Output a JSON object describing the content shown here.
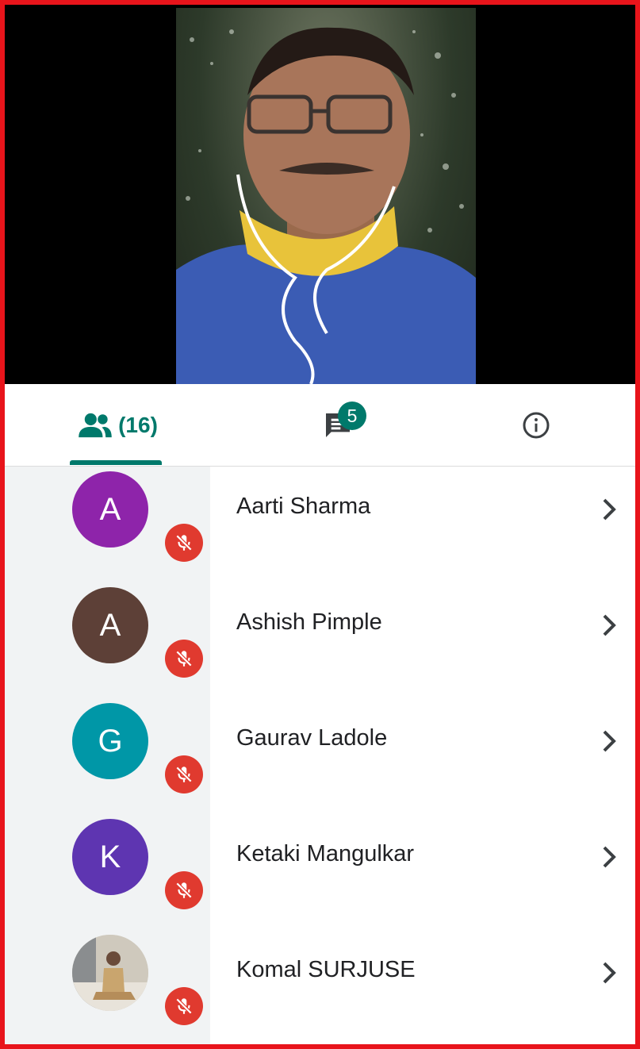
{
  "video": {
    "participant": "presenter"
  },
  "tabs": {
    "people_count": "(16)",
    "chat_badge": "5",
    "accent": "#00796b"
  },
  "participants": [
    {
      "initial": "A",
      "name": "Aarti Sharma",
      "color": "#8e24aa",
      "muted": true
    },
    {
      "initial": "A",
      "name": "Ashish Pimple",
      "color": "#5d4037",
      "muted": true
    },
    {
      "initial": "G",
      "name": "Gaurav Ladole",
      "color": "#0097a7",
      "muted": true
    },
    {
      "initial": "K",
      "name": "Ketaki Mangulkar",
      "color": "#5e35b1",
      "muted": true
    },
    {
      "initial": "",
      "name": "Komal SURJUSE",
      "color": "#d6d1c6",
      "muted": true,
      "photo": true
    }
  ],
  "colors": {
    "mute": "#e03a2f",
    "list_bg": "#f1f3f4",
    "border": "#e8141b"
  }
}
